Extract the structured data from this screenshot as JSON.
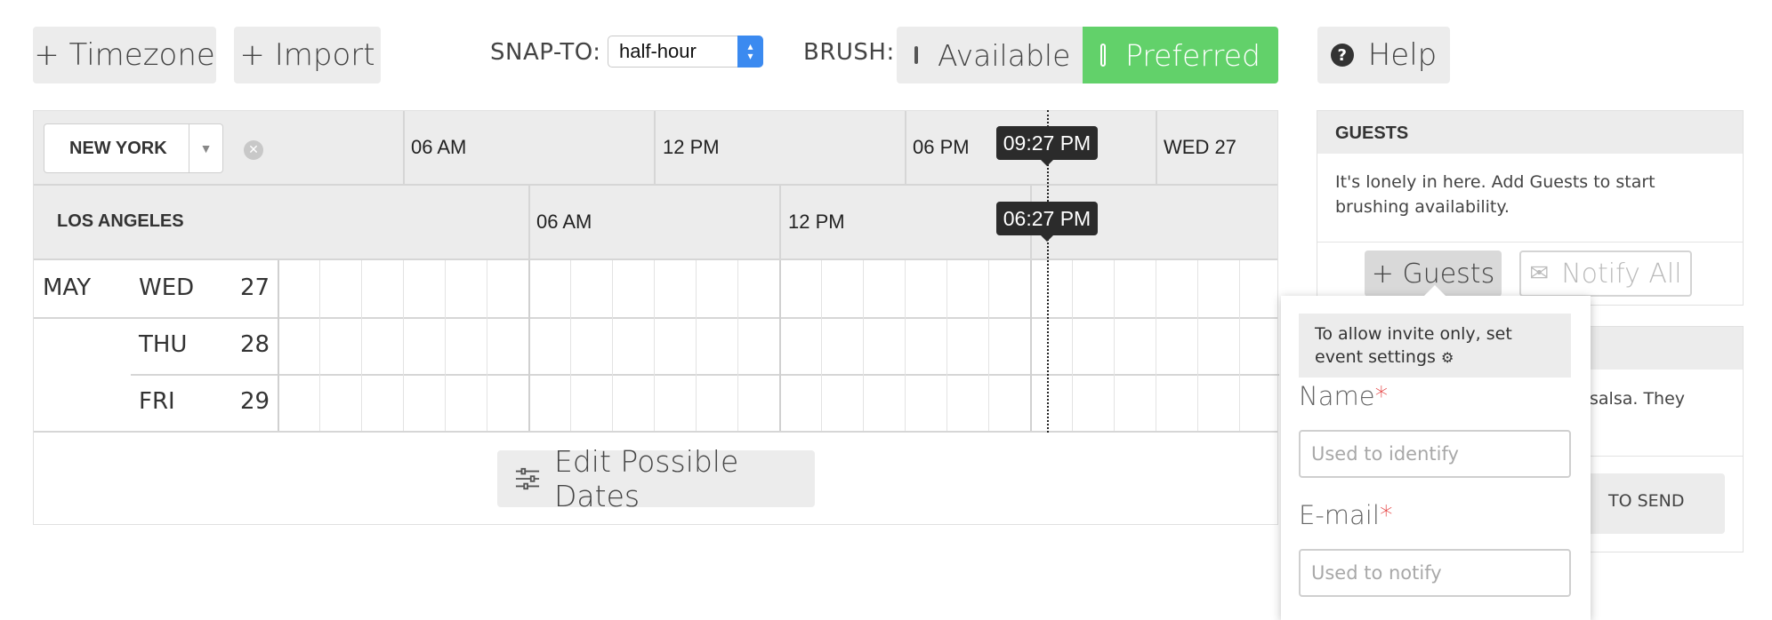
{
  "toolbar": {
    "timezone_label": "+ Timezone",
    "import_label": "+ Import",
    "snap_to_label": "SNAP-TO:",
    "snap_to_value": "half-hour",
    "brush_label": "BRUSH:",
    "brush_available": "Available",
    "brush_preferred": "Preferred",
    "help_label": "Help",
    "accent_color": "#62d16a"
  },
  "calendar": {
    "timezones": [
      {
        "name": "NEW YORK",
        "ticks": [
          "06 AM",
          "12 PM",
          "06 PM",
          "WED 27"
        ],
        "current_time": "09:27 PM"
      },
      {
        "name": "LOS ANGELES",
        "ticks": [
          "06 AM",
          "12 PM"
        ],
        "current_time": "06:27 PM"
      }
    ],
    "days": [
      {
        "month": "MAY",
        "weekday": "WED",
        "date": "27"
      },
      {
        "month": "",
        "weekday": "THU",
        "date": "28"
      },
      {
        "month": "",
        "weekday": "FRI",
        "date": "29"
      }
    ],
    "edit_dates_label": "Edit Possible Dates"
  },
  "guests_panel": {
    "title": "GUESTS",
    "empty_text": "It's lonely in here. Add Guests to start brushing availability.",
    "add_guests_label": "+ Guests",
    "notify_all_label": "Notify All"
  },
  "second_panel": {
    "partial_text": "salsa. They",
    "partial_button": "TO SEND"
  },
  "add_guest_popover": {
    "note": "To allow invite only, set event settings",
    "name_label": "Name",
    "name_placeholder": "Used to identify",
    "email_label": "E-mail",
    "email_placeholder": "Used to notify"
  }
}
